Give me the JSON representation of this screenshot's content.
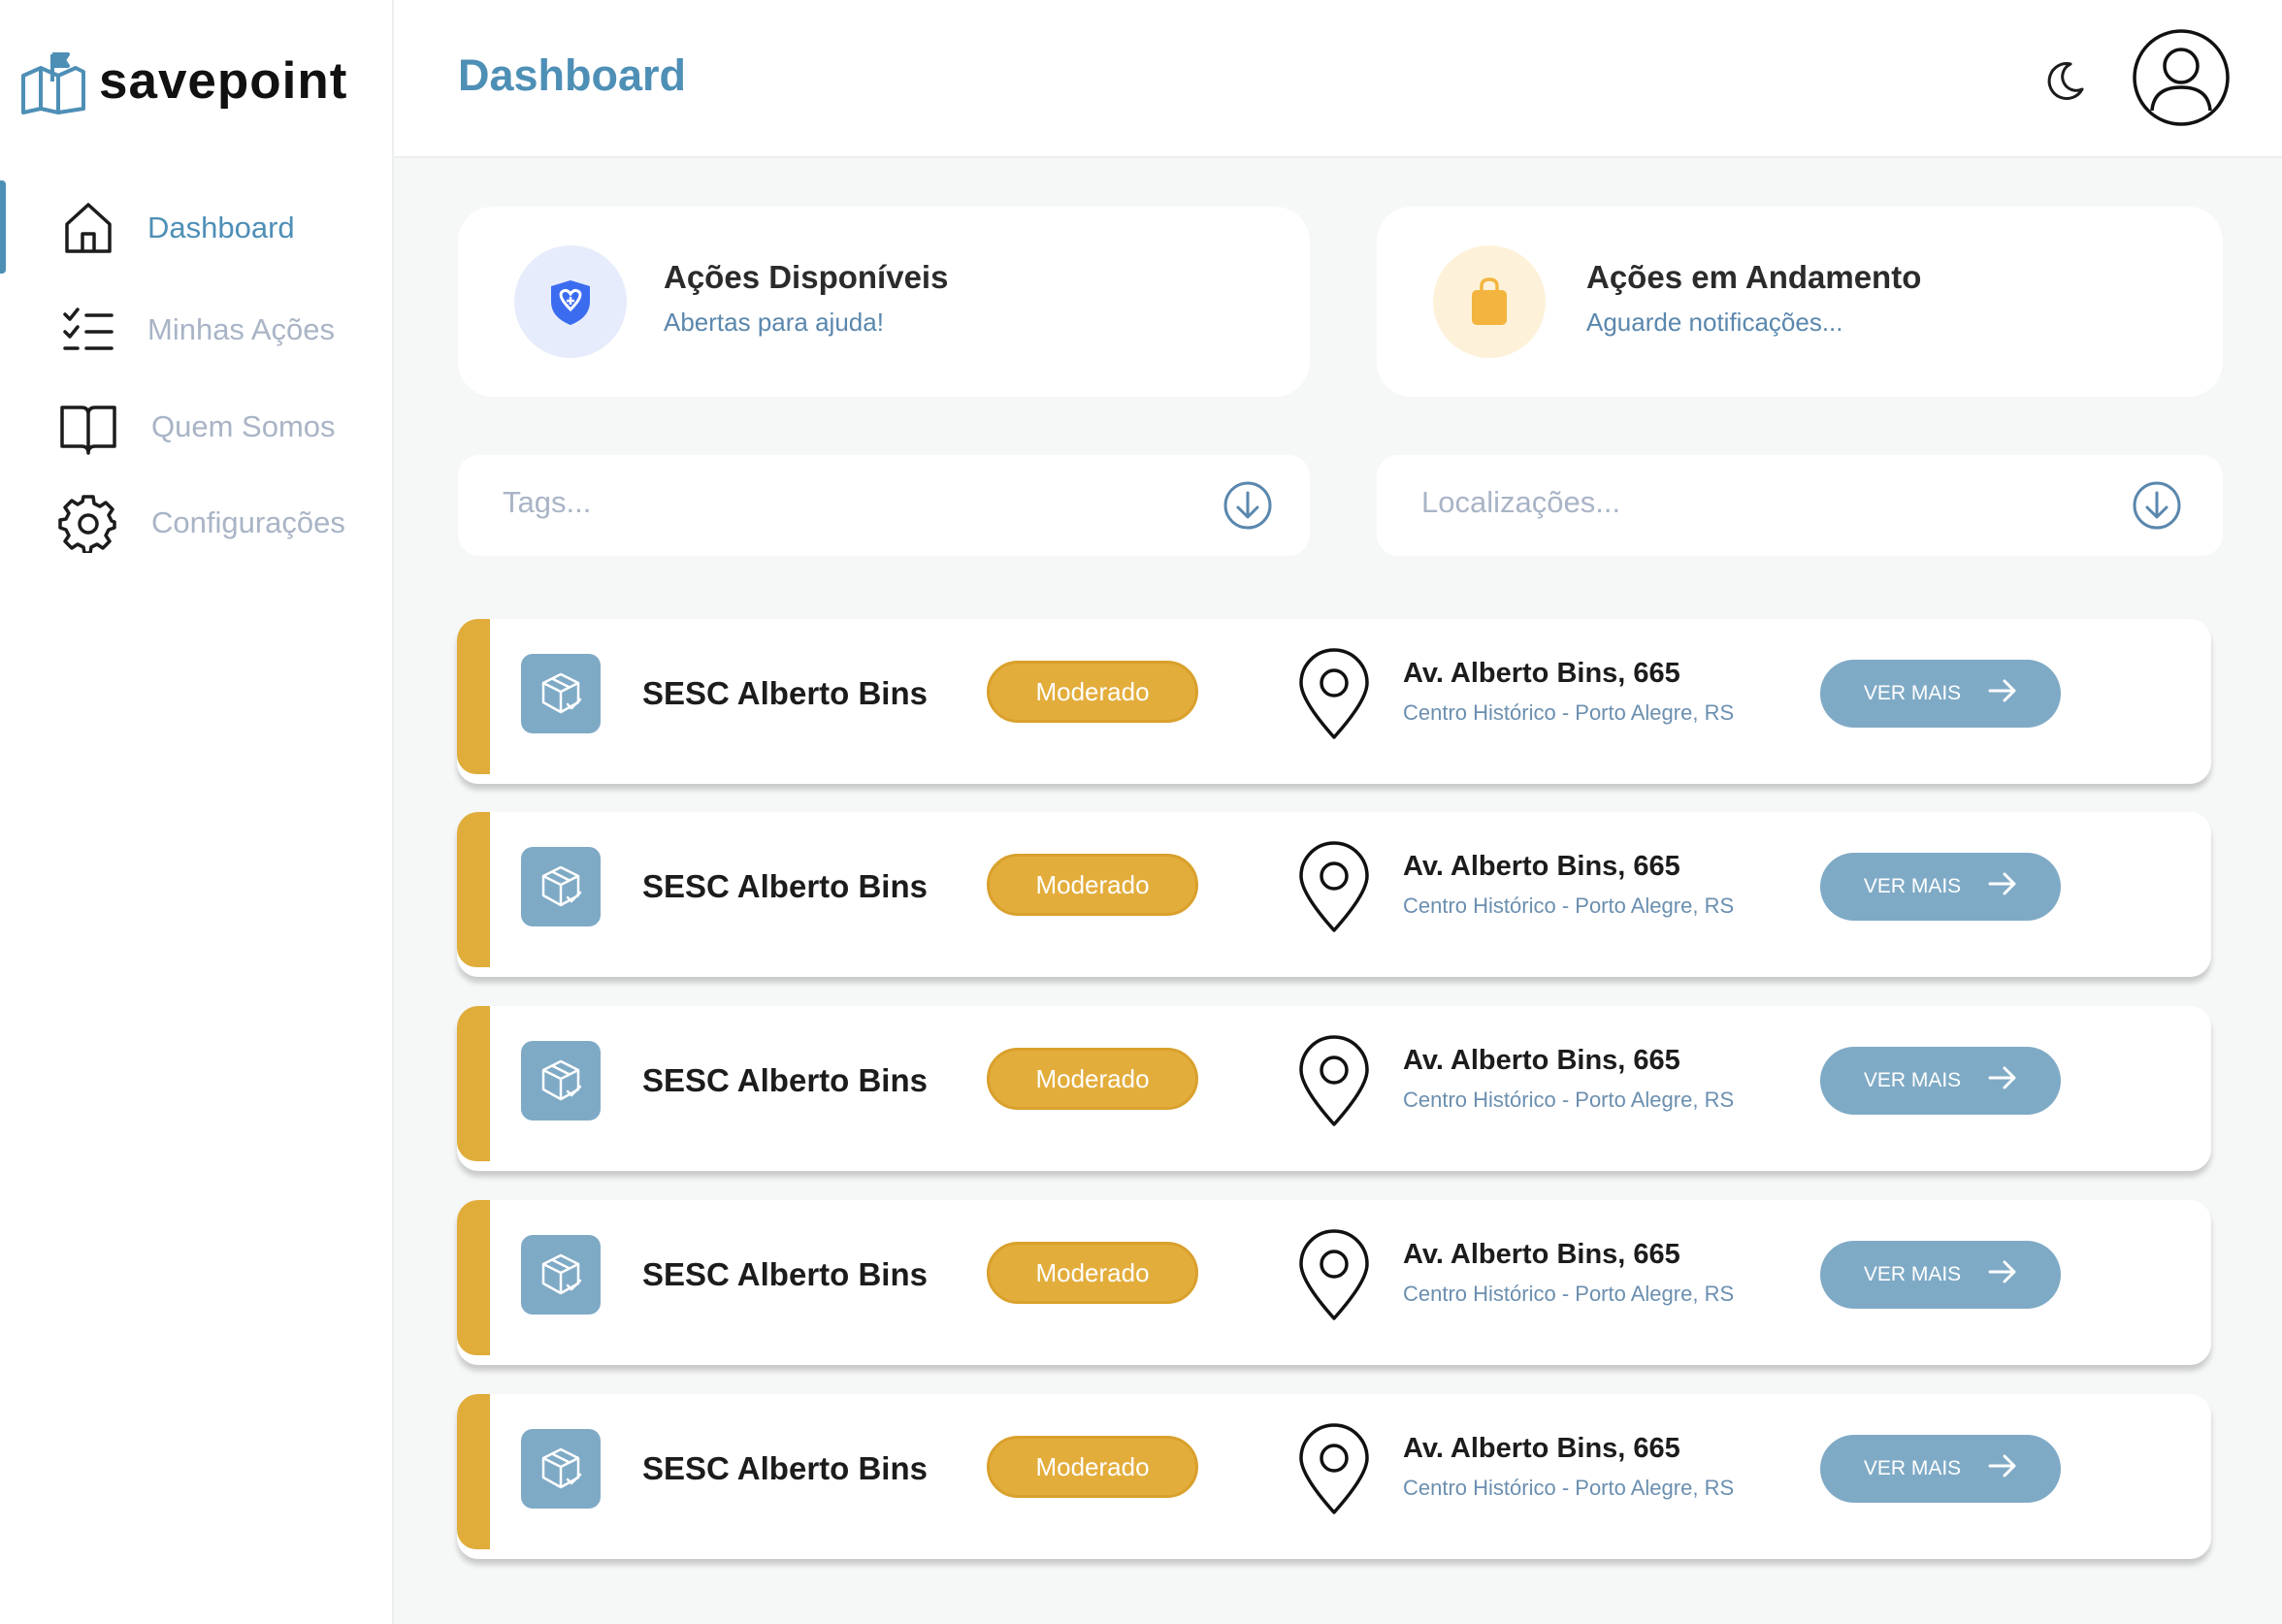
{
  "app": {
    "name": "savepoint"
  },
  "header": {
    "title": "Dashboard"
  },
  "sidebar": {
    "items": [
      {
        "label": "Dashboard",
        "icon": "home-icon",
        "active": true
      },
      {
        "label": "Minhas Ações",
        "icon": "checklist-icon",
        "active": false
      },
      {
        "label": "Quem Somos",
        "icon": "book-icon",
        "active": false
      },
      {
        "label": "Configurações",
        "icon": "gear-icon",
        "active": false
      }
    ]
  },
  "stats": [
    {
      "title": "Ações Disponíveis",
      "subtitle": "Abertas para ajuda!",
      "icon": "heart-shield-icon"
    },
    {
      "title": "Ações em Andamento",
      "subtitle": "Aguarde notificações...",
      "icon": "shopping-bag-icon"
    }
  ],
  "filters": {
    "tags_placeholder": "Tags...",
    "locations_placeholder": "Localizações..."
  },
  "list": [
    {
      "name": "SESC Alberto Bins",
      "badge": "Moderado",
      "address": "Av. Alberto Bins, 665",
      "district": "Centro Histórico - Porto Alegre, RS",
      "button": "VER MAIS"
    },
    {
      "name": "SESC Alberto Bins",
      "badge": "Moderado",
      "address": "Av. Alberto Bins, 665",
      "district": "Centro Histórico - Porto Alegre, RS",
      "button": "VER MAIS"
    },
    {
      "name": "SESC Alberto Bins",
      "badge": "Moderado",
      "address": "Av. Alberto Bins, 665",
      "district": "Centro Histórico - Porto Alegre, RS",
      "button": "VER MAIS"
    },
    {
      "name": "SESC Alberto Bins",
      "badge": "Moderado",
      "address": "Av. Alberto Bins, 665",
      "district": "Centro Histórico - Porto Alegre, RS",
      "button": "VER MAIS"
    },
    {
      "name": "SESC Alberto Bins",
      "badge": "Moderado",
      "address": "Av. Alberto Bins, 665",
      "district": "Centro Histórico - Porto Alegre, RS",
      "button": "VER MAIS"
    }
  ],
  "colors": {
    "primary": "#4e8fb6",
    "accent": "#e0ac3a",
    "muted": "#a9b4c6",
    "button": "#7faac6"
  }
}
